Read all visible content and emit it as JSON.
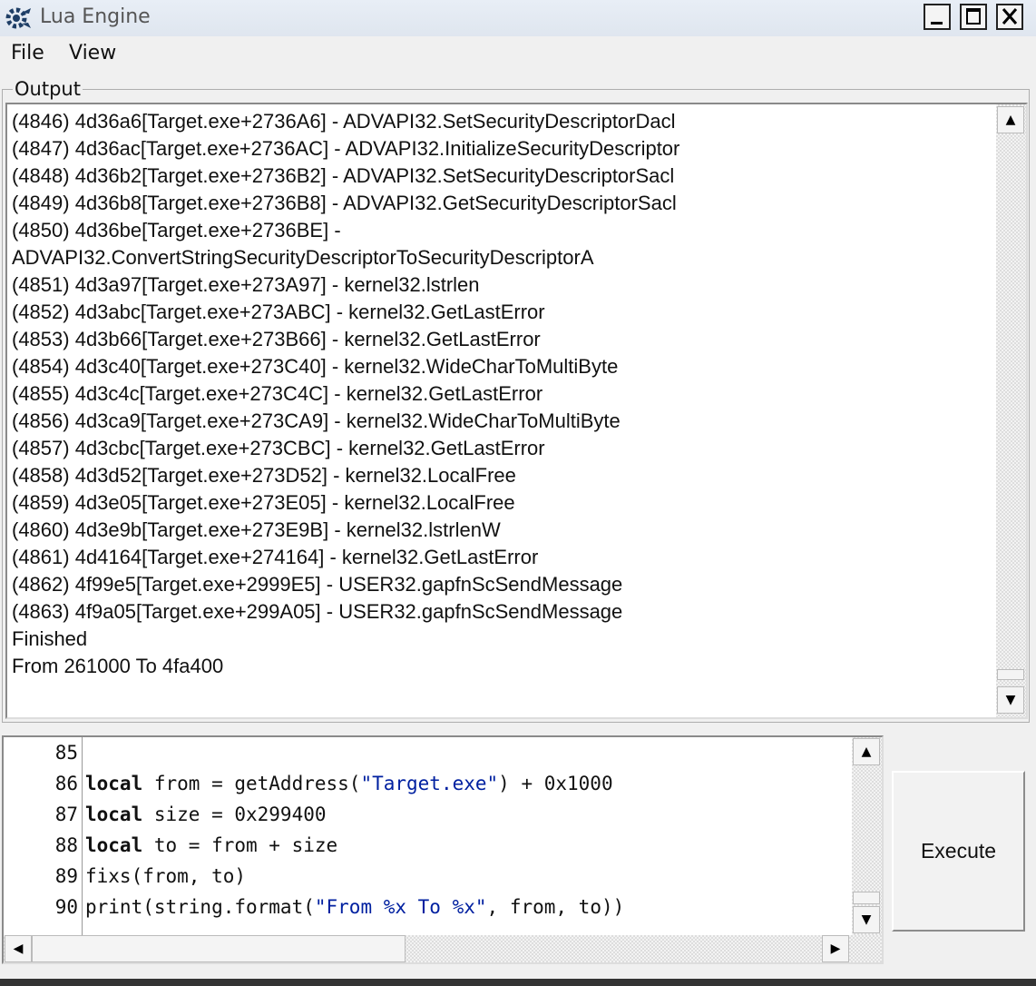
{
  "window": {
    "title": "Lua Engine"
  },
  "menu": {
    "file": "File",
    "view": "View"
  },
  "output": {
    "label": "Output",
    "lines": [
      "(4846) 4d36a6[Target.exe+2736A6] - ADVAPI32.SetSecurityDescriptorDacl",
      "(4847) 4d36ac[Target.exe+2736AC] - ADVAPI32.InitializeSecurityDescriptor",
      "(4848) 4d36b2[Target.exe+2736B2] - ADVAPI32.SetSecurityDescriptorSacl",
      "(4849) 4d36b8[Target.exe+2736B8] - ADVAPI32.GetSecurityDescriptorSacl",
      "(4850) 4d36be[Target.exe+2736BE] -",
      "ADVAPI32.ConvertStringSecurityDescriptorToSecurityDescriptorA",
      "(4851) 4d3a97[Target.exe+273A97] - kernel32.lstrlen",
      "(4852) 4d3abc[Target.exe+273ABC] - kernel32.GetLastError",
      "(4853) 4d3b66[Target.exe+273B66] - kernel32.GetLastError",
      "(4854) 4d3c40[Target.exe+273C40] - kernel32.WideCharToMultiByte",
      "(4855) 4d3c4c[Target.exe+273C4C] - kernel32.GetLastError",
      "(4856) 4d3ca9[Target.exe+273CA9] - kernel32.WideCharToMultiByte",
      "(4857) 4d3cbc[Target.exe+273CBC] - kernel32.GetLastError",
      "(4858) 4d3d52[Target.exe+273D52] - kernel32.LocalFree",
      "(4859) 4d3e05[Target.exe+273E05] - kernel32.LocalFree",
      "(4860) 4d3e9b[Target.exe+273E9B] - kernel32.lstrlenW",
      "(4861) 4d4164[Target.exe+274164] - kernel32.GetLastError",
      "(4862) 4f99e5[Target.exe+2999E5] - USER32.gapfnScSendMessage",
      "(4863) 4f9a05[Target.exe+299A05] - USER32.gapfnScSendMessage",
      "Finished",
      "From 261000 To 4fa400"
    ]
  },
  "editor": {
    "line_numbers": [
      "85",
      "86",
      "87",
      "88",
      "89",
      "90"
    ],
    "code": {
      "l86_kw": "local",
      "l86_a": " from = getAddress(",
      "l86_str": "\"Target.exe\"",
      "l86_b": ") + 0x1000",
      "l87_kw": "local",
      "l87_a": " size = 0x299400",
      "l88_kw": "local",
      "l88_a": " to = from + size",
      "l89": "fixs(from, to)",
      "l90_a": "print(string.format(",
      "l90_str": "\"From %x To %x\"",
      "l90_b": ", from, to))"
    }
  },
  "execute": {
    "label": "Execute"
  },
  "icons": {
    "app": "cheat-engine-gear-icon",
    "minimize": "minimize-icon",
    "maximize": "maximize-icon",
    "close": "close-icon",
    "up": "arrow-up-icon",
    "down": "arrow-down-icon",
    "left": "arrow-left-icon",
    "right": "arrow-right-icon"
  }
}
